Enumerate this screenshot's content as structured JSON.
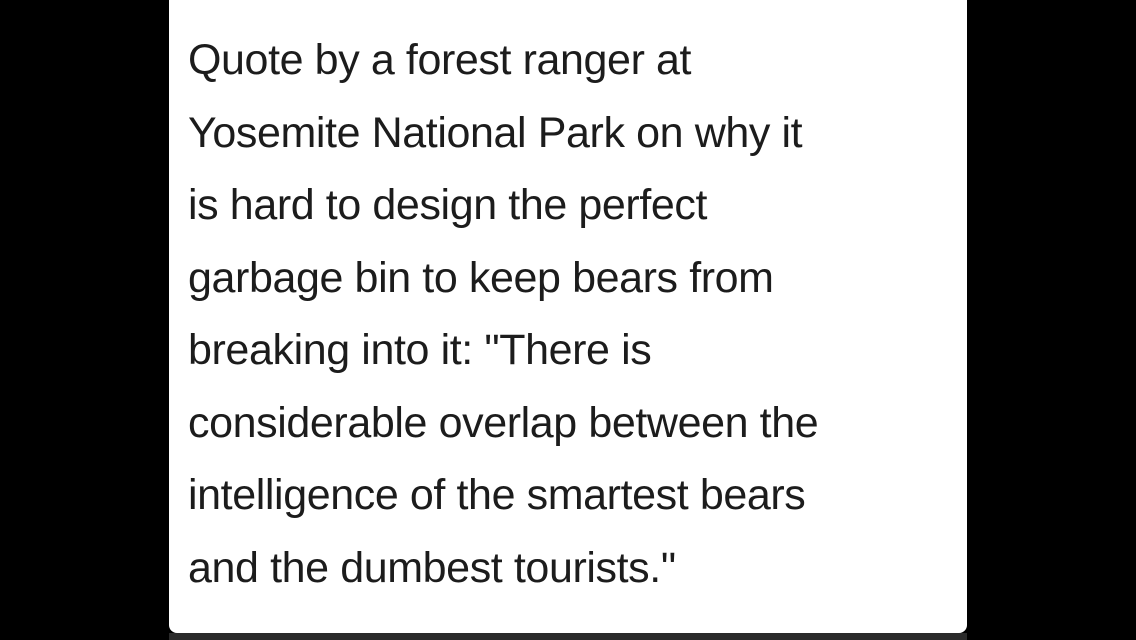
{
  "quote": {
    "lines": [
      "Quote by a forest ranger at",
      "Yosemite National Park on why it",
      "is hard to design the perfect",
      "garbage bin to keep bears from",
      "breaking into it:  \"There is",
      "considerable overlap between the",
      "intelligence of the smartest bears",
      "and the dumbest tourists.\""
    ]
  },
  "colors": {
    "background": "#000000",
    "card": "#ffffff",
    "text": "#1c1c1c"
  }
}
